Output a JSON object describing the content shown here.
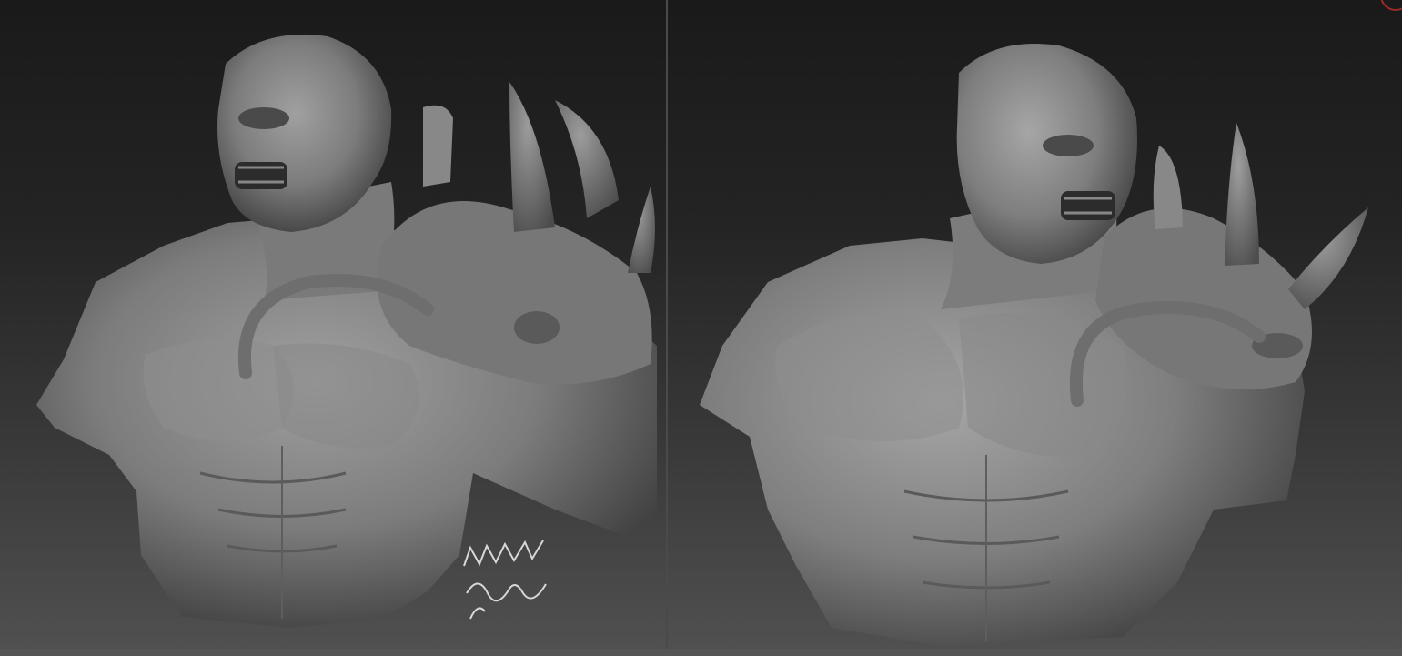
{
  "viewports": [
    {
      "id": "left",
      "subject": "creature-bust-sculpt-front-three-quarter"
    },
    {
      "id": "right",
      "subject": "creature-bust-sculpt-side-three-quarter"
    }
  ],
  "signature": {
    "line1": "BRETT",
    "line2": "Sinclair"
  },
  "colors": {
    "background_top": "#1a1a1a",
    "background_bottom": "#505050",
    "sculpt_clay": "#8a8a8a",
    "divider": "#4a4a4a",
    "corner_accent": "#9a2a2a"
  }
}
